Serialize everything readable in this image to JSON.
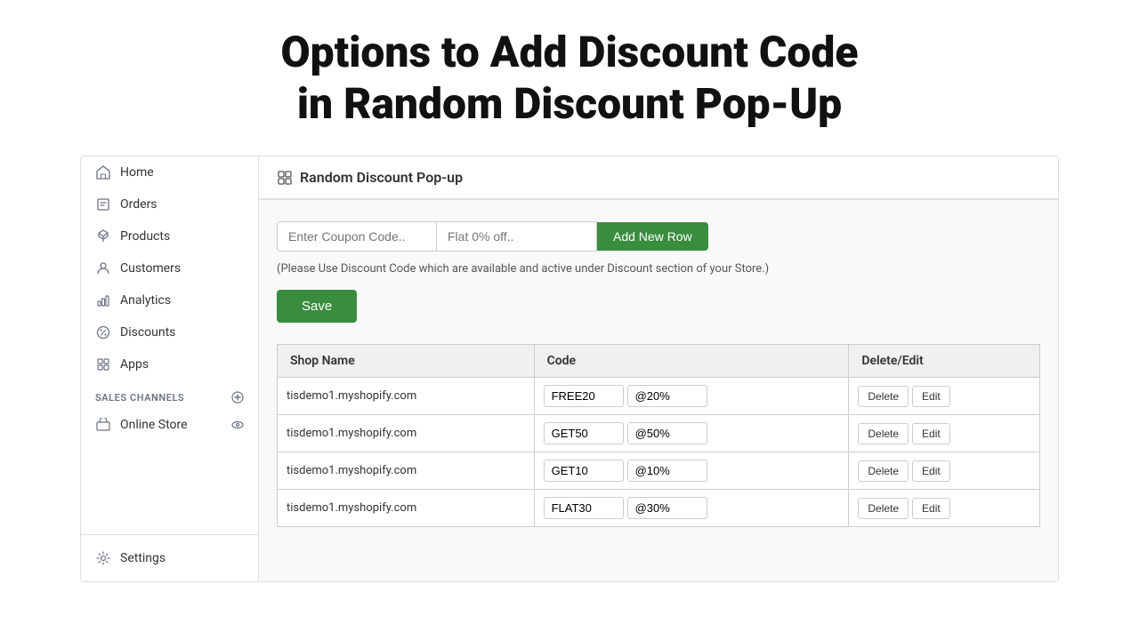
{
  "page": {
    "title_line1": "Options to Add Discount Code",
    "title_line2": "in Random Discount Pop-Up"
  },
  "sidebar": {
    "nav_items": [
      {
        "id": "home",
        "label": "Home",
        "icon": "home-icon"
      },
      {
        "id": "orders",
        "label": "Orders",
        "icon": "orders-icon"
      },
      {
        "id": "products",
        "label": "Products",
        "icon": "products-icon"
      },
      {
        "id": "customers",
        "label": "Customers",
        "icon": "customers-icon"
      },
      {
        "id": "analytics",
        "label": "Analytics",
        "icon": "analytics-icon"
      },
      {
        "id": "discounts",
        "label": "Discounts",
        "icon": "discounts-icon"
      },
      {
        "id": "apps",
        "label": "Apps",
        "icon": "apps-icon"
      }
    ],
    "sales_channels_label": "SALES CHANNELS",
    "channels": [
      {
        "id": "online-store",
        "label": "Online Store"
      }
    ],
    "settings_label": "Settings"
  },
  "panel": {
    "title": "Random Discount Pop-up",
    "coupon_placeholder": "Enter Coupon Code..",
    "flat_placeholder": "Flat 0% off..",
    "add_button_label": "Add New Row",
    "disclaimer": "(Please Use Discount Code which are available and active under Discount section of your Store.)",
    "save_button_label": "Save",
    "table": {
      "headers": [
        "Shop Name",
        "Code",
        "Delete/Edit"
      ],
      "rows": [
        {
          "shop": "tisdemo1.myshopify.com",
          "code": "FREE20",
          "percent": "@20%"
        },
        {
          "shop": "tisdemo1.myshopify.com",
          "code": "GET50",
          "percent": "@50%"
        },
        {
          "shop": "tisdemo1.myshopify.com",
          "code": "GET10",
          "percent": "@10%"
        },
        {
          "shop": "tisdemo1.myshopify.com",
          "code": "FLAT30",
          "percent": "@30%"
        }
      ],
      "delete_label": "Delete",
      "edit_label": "Edit"
    }
  }
}
